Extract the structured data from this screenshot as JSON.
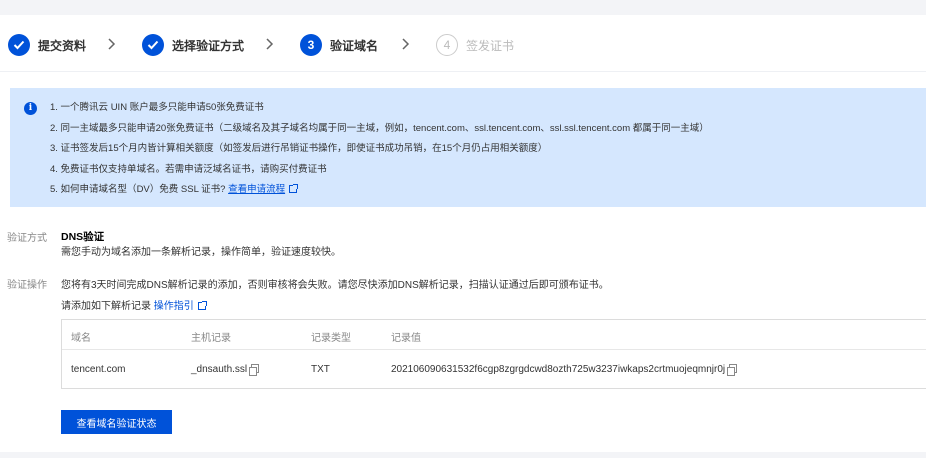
{
  "steps": [
    {
      "label": "提交资料",
      "number": "",
      "state": "done"
    },
    {
      "label": "选择验证方式",
      "number": "",
      "state": "done"
    },
    {
      "label": "验证域名",
      "number": "3",
      "state": "active"
    },
    {
      "label": "签发证书",
      "number": "4",
      "state": "todo"
    }
  ],
  "notice": {
    "icon": "info-icon",
    "items": [
      "1. 一个腾讯云 UIN 账户最多只能申请50张免费证书",
      "2. 同一主域最多只能申请20张免费证书（二级域名及其子域名均属于同一主域，例如，tencent.com、ssl.tencent.com、ssl.ssl.tencent.com 都属于同一主域）",
      "3. 证书签发后15个月内皆计算相关额度（如签发后进行吊销证书操作，即使证书成功吊销，在15个月仍占用相关额度）",
      "4. 免费证书仅支持单域名。若需申请泛域名证书，请购买付费证书"
    ],
    "item5_prefix": "5. 如何申请域名型（DV）免费 SSL 证书?",
    "item5_link": "查看申请流程"
  },
  "method": {
    "label": "验证方式",
    "title": "DNS验证",
    "desc": "需您手动为域名添加一条解析记录，操作简单，验证速度较快。"
  },
  "operation": {
    "label": "验证操作",
    "text": "您将有3天时间完成DNS解析记录的添加，否则审核将会失败。请您尽快添加DNS解析记录，扫描认证通过后即可颁布证书。",
    "sub_prefix": "请添加如下解析记录",
    "sub_link": "操作指引"
  },
  "table": {
    "headers": [
      "域名",
      "主机记录",
      "记录类型",
      "记录值"
    ],
    "row": {
      "domain": "tencent.com",
      "host": "_dnsauth.ssl",
      "type": "TXT",
      "value": "202106090631532f6cgp8zgrgdcwd8ozth725w3237iwkaps2crtmuojeqmnjr0j"
    }
  },
  "button": {
    "label": "查看域名验证状态"
  },
  "colors": {
    "primary": "#0052d9",
    "notice_bg": "#d5e7fe"
  }
}
